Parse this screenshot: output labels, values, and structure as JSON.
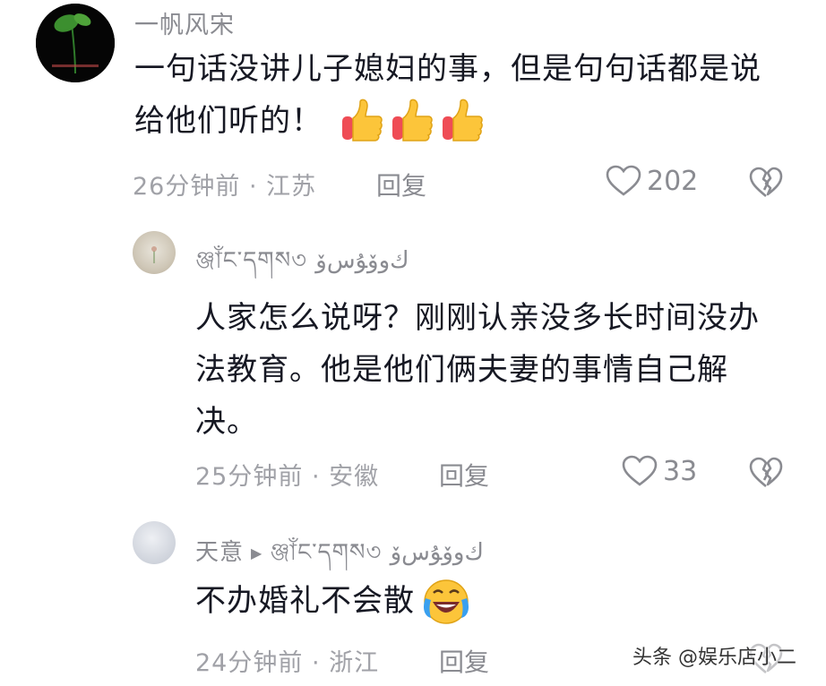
{
  "comments": [
    {
      "username": "一帆风宋",
      "text_lines": [
        "一句话没讲儿子媳妇的事，但是句句话都是说",
        "给他们听的！"
      ],
      "emojis": [
        "thumbs-up-icon",
        "thumbs-up-icon",
        "thumbs-up-icon"
      ],
      "time": "26分钟前 · 江苏",
      "reply_label": "回复",
      "likes": "202"
    },
    {
      "username": "ঞ্জাঁང་དགས৩ ﻙﻭﯙﯘسﯙ",
      "text_lines": [
        "人家怎么说呀？刚刚认亲没多长时间没办",
        "法教育。他是他们俩夫妻的事情自己解",
        "决。"
      ],
      "time": "25分钟前 · 安徽",
      "reply_label": "回复",
      "likes": "33"
    },
    {
      "username": "天意",
      "reply_to": "ঞ্জাঁང་དགས৩ ﻙﻭﯙﯘسﯙ",
      "text": "不办婚礼不会散",
      "emoji": "laughing-crying-icon",
      "time": "24分钟前 · 浙江",
      "reply_label": "回复"
    }
  ],
  "watermark": "头条 @娱乐店小二",
  "colors": {
    "text": "#161823",
    "muted": "#8a8b91",
    "meta": "#a0a1a7"
  }
}
